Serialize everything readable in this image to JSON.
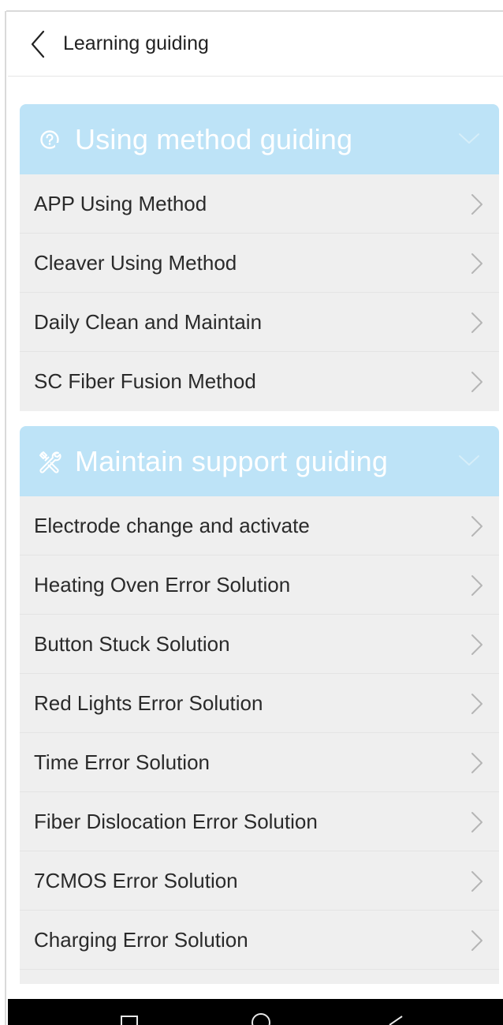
{
  "header": {
    "title": "Learning guiding"
  },
  "sections": [
    {
      "title": "Using method guiding",
      "icon": "question-gear-icon",
      "items": [
        {
          "label": "APP Using Method"
        },
        {
          "label": "Cleaver Using Method"
        },
        {
          "label": "Daily Clean and Maintain"
        },
        {
          "label": "SC Fiber Fusion Method"
        }
      ]
    },
    {
      "title": "Maintain support guiding",
      "icon": "tools-icon",
      "items": [
        {
          "label": "Electrode change and activate"
        },
        {
          "label": "Heating Oven Error Solution"
        },
        {
          "label": "Button Stuck Solution"
        },
        {
          "label": "Red Lights Error Solution"
        },
        {
          "label": "Time Error Solution"
        },
        {
          "label": "Fiber Dislocation Error Solution"
        },
        {
          "label": "7CMOS Error Solution"
        },
        {
          "label": "Charging Error Solution"
        }
      ]
    }
  ],
  "navbar": {
    "buttons": [
      "recents-icon",
      "home-icon",
      "back-triangle-icon"
    ]
  },
  "colors": {
    "section_header_bg": "#bde3f7",
    "list_bg": "#efefef",
    "section_title": "#ffffff"
  }
}
